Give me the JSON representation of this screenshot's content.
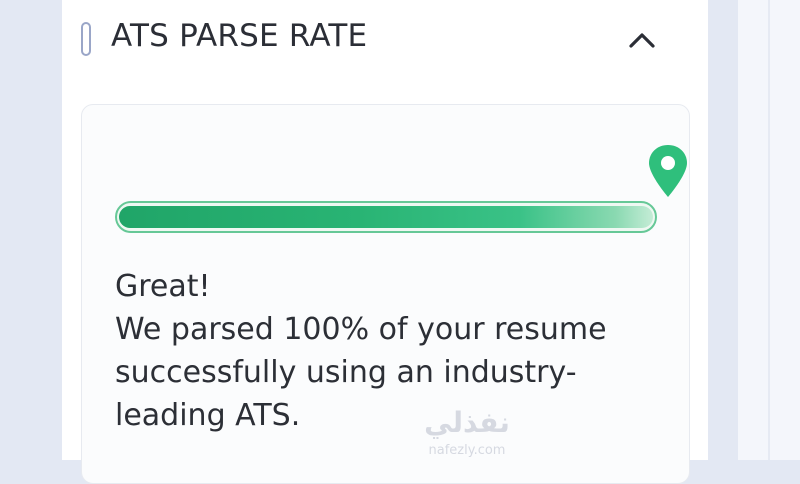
{
  "section": {
    "title": "ATS PARSE RATE",
    "toggle_icon": "chevron-up-icon",
    "marker_icon": "section-marker-icon"
  },
  "result": {
    "pin_icon": "location-pin-icon",
    "parse_rate_percent": 100,
    "heading": "Great!",
    "body": "We parsed 100% of your resume successfully using an industry-leading ATS."
  },
  "watermark": {
    "text": "نفذلي",
    "domain": "nafezly.com"
  },
  "colors": {
    "accent_green": "#29b474",
    "text_dark": "#2c2f36",
    "page_bg": "#e3e8f3"
  }
}
